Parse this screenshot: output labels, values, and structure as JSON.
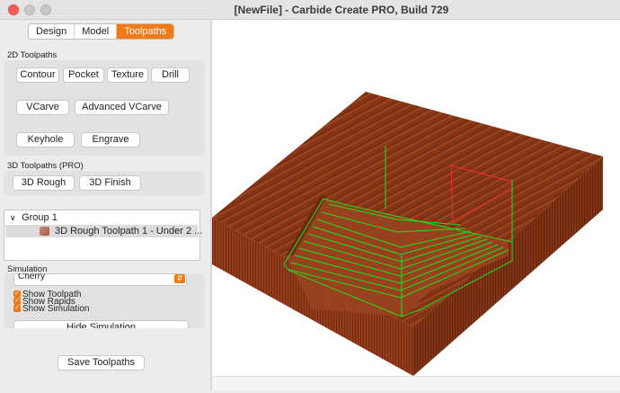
{
  "window": {
    "title": "[NewFile] - Carbide Create PRO, Build 729"
  },
  "tabs": [
    {
      "label": "Design"
    },
    {
      "label": "Model"
    },
    {
      "label": "Toolpaths",
      "active": true
    }
  ],
  "toolpaths_2d": {
    "heading": "2D Toolpaths",
    "buttons": [
      "Contour",
      "Pocket",
      "Texture",
      "Drill",
      "VCarve",
      "Advanced VCarve",
      "Keyhole",
      "Engrave"
    ]
  },
  "toolpaths_3d": {
    "heading": "3D Toolpaths (PRO)",
    "buttons": [
      "3D Rough",
      "3D Finish"
    ]
  },
  "tree": {
    "group": "Group 1",
    "item": "3D Rough Toolpath 1 - Under 2 ..."
  },
  "simulation": {
    "heading": "Simulation",
    "material": "Cherry",
    "checkboxes": [
      {
        "label": "Show Toolpath",
        "checked": true
      },
      {
        "label": "Show Rapids",
        "checked": true
      },
      {
        "label": "Show Simulation",
        "checked": true
      }
    ],
    "hide_button": "Hide Simulation"
  },
  "save_button": "Save Toolpaths",
  "colors": {
    "accent": "#f07a18",
    "wood": "#8a3516",
    "toolpath": "#1fd31f",
    "rapid": "#ff2a2a"
  }
}
